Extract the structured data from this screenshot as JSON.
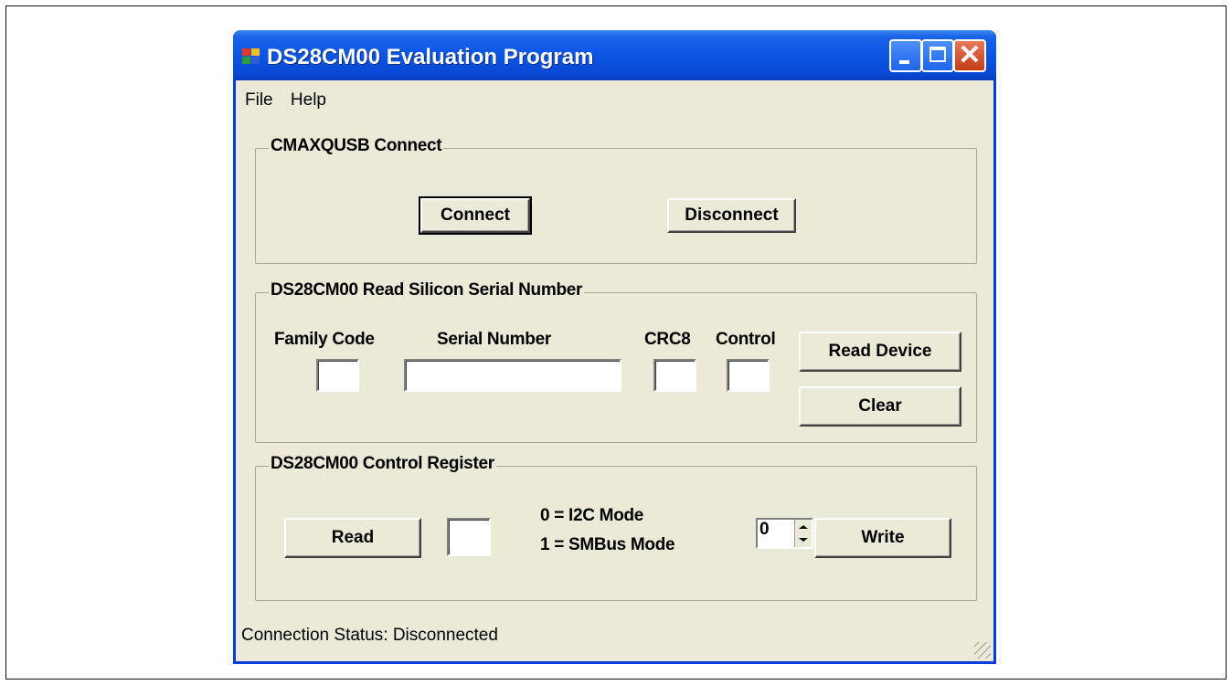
{
  "window": {
    "title": "DS28CM00 Evaluation Program"
  },
  "menu": {
    "file": "File",
    "help": "Help"
  },
  "connect_group": {
    "title": "CMAXQUSB Connect",
    "connect_label": "Connect",
    "disconnect_label": "Disconnect"
  },
  "serial_group": {
    "title": "DS28CM00 Read Silicon Serial Number",
    "family_code_label": "Family Code",
    "serial_number_label": "Serial Number",
    "crc8_label": "CRC8",
    "control_label": "Control",
    "read_device_label": "Read Device",
    "clear_label": "Clear",
    "family_code_value": "",
    "serial_number_value": "",
    "crc8_value": "",
    "control_value": ""
  },
  "control_group": {
    "title": "DS28CM00 Control Register",
    "read_label": "Read",
    "register_value": "",
    "mode0_text": "0 = I2C Mode",
    "mode1_text": "1 = SMBus Mode",
    "spin_value": "0",
    "write_label": "Write"
  },
  "status": {
    "text": "Connection Status:  Disconnected"
  },
  "colors": {
    "title_bar": "#0a55e4",
    "window_bg": "#ece9d8",
    "close_button": "#c43b15"
  }
}
